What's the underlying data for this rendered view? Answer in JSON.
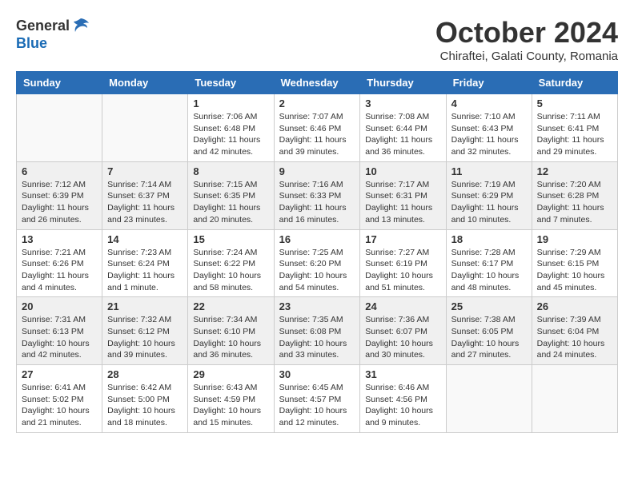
{
  "header": {
    "logo_general": "General",
    "logo_blue": "Blue",
    "month_title": "October 2024",
    "subtitle": "Chiraftei, Galati County, Romania"
  },
  "calendar": {
    "days_of_week": [
      "Sunday",
      "Monday",
      "Tuesday",
      "Wednesday",
      "Thursday",
      "Friday",
      "Saturday"
    ],
    "weeks": [
      [
        {
          "day": "",
          "info": ""
        },
        {
          "day": "",
          "info": ""
        },
        {
          "day": "1",
          "info": "Sunrise: 7:06 AM\nSunset: 6:48 PM\nDaylight: 11 hours and 42 minutes."
        },
        {
          "day": "2",
          "info": "Sunrise: 7:07 AM\nSunset: 6:46 PM\nDaylight: 11 hours and 39 minutes."
        },
        {
          "day": "3",
          "info": "Sunrise: 7:08 AM\nSunset: 6:44 PM\nDaylight: 11 hours and 36 minutes."
        },
        {
          "day": "4",
          "info": "Sunrise: 7:10 AM\nSunset: 6:43 PM\nDaylight: 11 hours and 32 minutes."
        },
        {
          "day": "5",
          "info": "Sunrise: 7:11 AM\nSunset: 6:41 PM\nDaylight: 11 hours and 29 minutes."
        }
      ],
      [
        {
          "day": "6",
          "info": "Sunrise: 7:12 AM\nSunset: 6:39 PM\nDaylight: 11 hours and 26 minutes."
        },
        {
          "day": "7",
          "info": "Sunrise: 7:14 AM\nSunset: 6:37 PM\nDaylight: 11 hours and 23 minutes."
        },
        {
          "day": "8",
          "info": "Sunrise: 7:15 AM\nSunset: 6:35 PM\nDaylight: 11 hours and 20 minutes."
        },
        {
          "day": "9",
          "info": "Sunrise: 7:16 AM\nSunset: 6:33 PM\nDaylight: 11 hours and 16 minutes."
        },
        {
          "day": "10",
          "info": "Sunrise: 7:17 AM\nSunset: 6:31 PM\nDaylight: 11 hours and 13 minutes."
        },
        {
          "day": "11",
          "info": "Sunrise: 7:19 AM\nSunset: 6:29 PM\nDaylight: 11 hours and 10 minutes."
        },
        {
          "day": "12",
          "info": "Sunrise: 7:20 AM\nSunset: 6:28 PM\nDaylight: 11 hours and 7 minutes."
        }
      ],
      [
        {
          "day": "13",
          "info": "Sunrise: 7:21 AM\nSunset: 6:26 PM\nDaylight: 11 hours and 4 minutes."
        },
        {
          "day": "14",
          "info": "Sunrise: 7:23 AM\nSunset: 6:24 PM\nDaylight: 11 hours and 1 minute."
        },
        {
          "day": "15",
          "info": "Sunrise: 7:24 AM\nSunset: 6:22 PM\nDaylight: 10 hours and 58 minutes."
        },
        {
          "day": "16",
          "info": "Sunrise: 7:25 AM\nSunset: 6:20 PM\nDaylight: 10 hours and 54 minutes."
        },
        {
          "day": "17",
          "info": "Sunrise: 7:27 AM\nSunset: 6:19 PM\nDaylight: 10 hours and 51 minutes."
        },
        {
          "day": "18",
          "info": "Sunrise: 7:28 AM\nSunset: 6:17 PM\nDaylight: 10 hours and 48 minutes."
        },
        {
          "day": "19",
          "info": "Sunrise: 7:29 AM\nSunset: 6:15 PM\nDaylight: 10 hours and 45 minutes."
        }
      ],
      [
        {
          "day": "20",
          "info": "Sunrise: 7:31 AM\nSunset: 6:13 PM\nDaylight: 10 hours and 42 minutes."
        },
        {
          "day": "21",
          "info": "Sunrise: 7:32 AM\nSunset: 6:12 PM\nDaylight: 10 hours and 39 minutes."
        },
        {
          "day": "22",
          "info": "Sunrise: 7:34 AM\nSunset: 6:10 PM\nDaylight: 10 hours and 36 minutes."
        },
        {
          "day": "23",
          "info": "Sunrise: 7:35 AM\nSunset: 6:08 PM\nDaylight: 10 hours and 33 minutes."
        },
        {
          "day": "24",
          "info": "Sunrise: 7:36 AM\nSunset: 6:07 PM\nDaylight: 10 hours and 30 minutes."
        },
        {
          "day": "25",
          "info": "Sunrise: 7:38 AM\nSunset: 6:05 PM\nDaylight: 10 hours and 27 minutes."
        },
        {
          "day": "26",
          "info": "Sunrise: 7:39 AM\nSunset: 6:04 PM\nDaylight: 10 hours and 24 minutes."
        }
      ],
      [
        {
          "day": "27",
          "info": "Sunrise: 6:41 AM\nSunset: 5:02 PM\nDaylight: 10 hours and 21 minutes."
        },
        {
          "day": "28",
          "info": "Sunrise: 6:42 AM\nSunset: 5:00 PM\nDaylight: 10 hours and 18 minutes."
        },
        {
          "day": "29",
          "info": "Sunrise: 6:43 AM\nSunset: 4:59 PM\nDaylight: 10 hours and 15 minutes."
        },
        {
          "day": "30",
          "info": "Sunrise: 6:45 AM\nSunset: 4:57 PM\nDaylight: 10 hours and 12 minutes."
        },
        {
          "day": "31",
          "info": "Sunrise: 6:46 AM\nSunset: 4:56 PM\nDaylight: 10 hours and 9 minutes."
        },
        {
          "day": "",
          "info": ""
        },
        {
          "day": "",
          "info": ""
        }
      ]
    ]
  }
}
